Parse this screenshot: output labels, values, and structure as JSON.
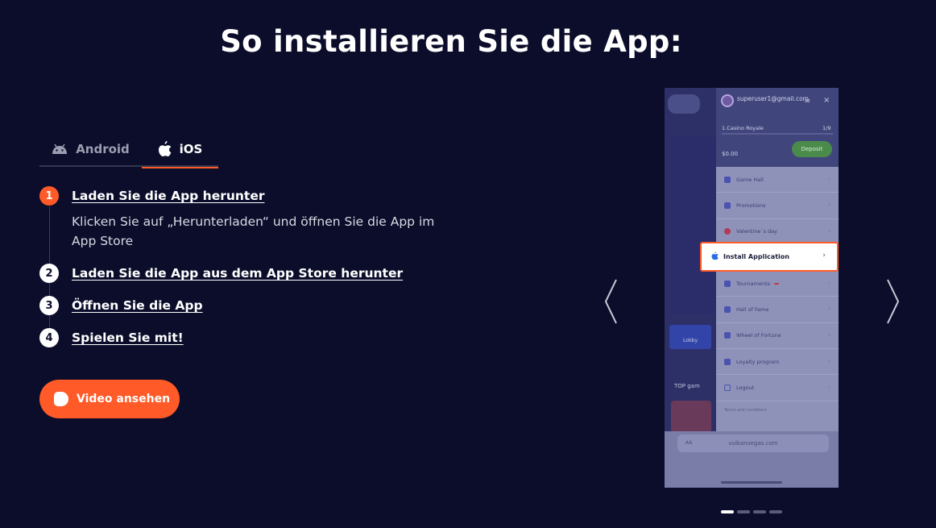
{
  "page_title": "So installieren Sie die App:",
  "tabs": [
    {
      "label": "Android",
      "icon": "android-icon",
      "active": false
    },
    {
      "label": "iOS",
      "icon": "apple-icon",
      "active": true
    }
  ],
  "steps": [
    {
      "num": "1",
      "title": "Laden Sie die App herunter",
      "desc": "Klicken Sie auf „Herunterladen“ und öffnen Sie die App im App Store"
    },
    {
      "num": "2",
      "title": "Laden Sie die App aus dem App Store herunter"
    },
    {
      "num": "3",
      "title": "Öffnen Sie die App"
    },
    {
      "num": "4",
      "title": "Spielen Sie mit!"
    }
  ],
  "video_button": {
    "label": "Video ansehen",
    "icon": "play-icon"
  },
  "phone": {
    "email": "superuser1@gmail.com",
    "status_value": "1.Casino Royale",
    "level_value": "1/9",
    "balance_value": "$0.00",
    "deposit_label": "Deposit",
    "lobby_label": "Lobby",
    "top_games_label": "TOP gam",
    "menu_items": [
      "Game Hall",
      "Promotions",
      "Valentine`s day",
      "Install Application",
      "Tournaments",
      "Hall of Fame",
      "Wheel of Fortune",
      "Loyalty program",
      "Logout"
    ],
    "terms_label": "Terms and conditions",
    "url": "vulkanvegas.com",
    "url_aa": "AA"
  },
  "carousel": {
    "dots": 4,
    "active_index": 0
  },
  "colors": {
    "background": "#0b0d2b",
    "accent": "#ff5a27"
  }
}
